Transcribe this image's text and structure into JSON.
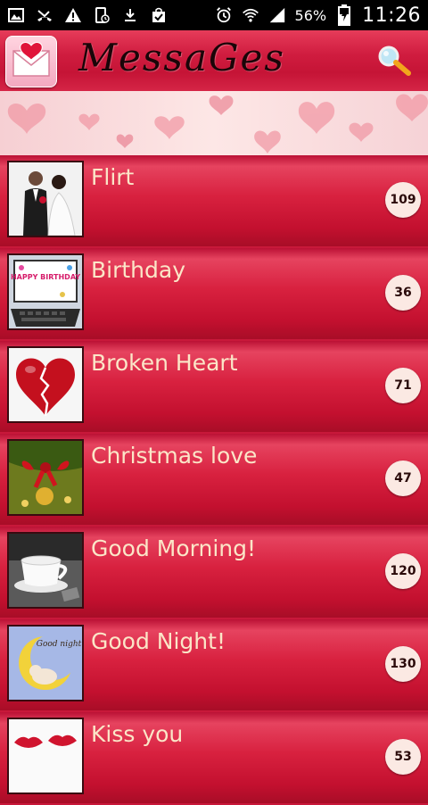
{
  "status_bar": {
    "battery_percent": "56%",
    "time": "11:26"
  },
  "app_bar": {
    "title": "MessaGes"
  },
  "categories": [
    {
      "label": "Flirt",
      "count": "109"
    },
    {
      "label": "Birthday",
      "count": "36"
    },
    {
      "label": "Broken Heart",
      "count": "71"
    },
    {
      "label": "Christmas love",
      "count": "47"
    },
    {
      "label": "Good Morning!",
      "count": "120"
    },
    {
      "label": "Good Night!",
      "count": "130"
    },
    {
      "label": "Kiss you",
      "count": "53"
    }
  ],
  "thumbnail_text": {
    "birthday": "HAPPY BIRTHDAY",
    "good_night": "Good night"
  },
  "colors": {
    "accent": "#c8183a",
    "label_text": "#fbe6c8",
    "badge_bg": "#fbe9e3"
  }
}
